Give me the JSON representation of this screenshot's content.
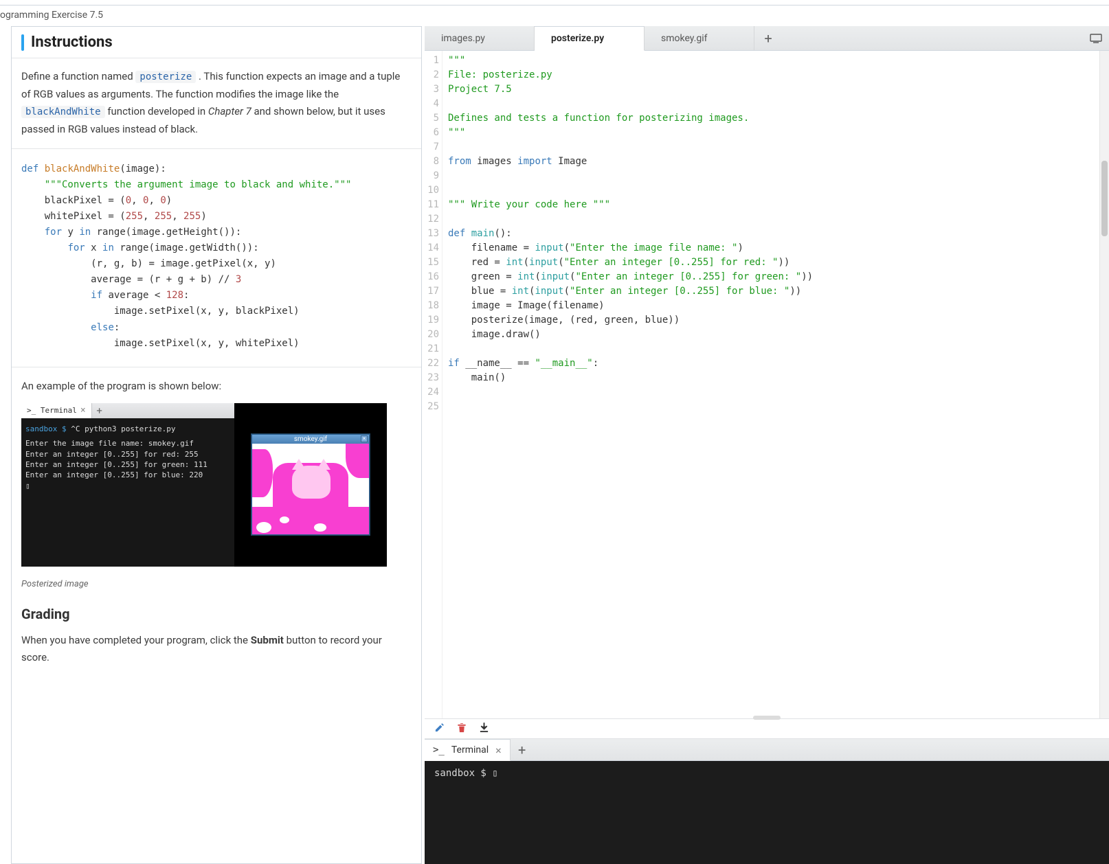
{
  "breadcrumb": "ogramming Exercise 7.5",
  "instructions": {
    "title": "Instructions",
    "p1a": "Define a function named ",
    "code1": "posterize",
    "p1b": ". This function expects an image and a tuple of RGB values as arguments. The function modifies the image like the ",
    "code2": "blackAndWhite",
    "p1c": " function developed in ",
    "chapter": "Chapter 7",
    "p1d": " and shown below, but it uses passed in RGB values instead of black.",
    "codeblock": {
      "l1a": "def",
      "l1b": "blackAndWhite",
      "l1c": "(image):",
      "l2": "\"\"\"Converts the argument image to black and white.\"\"\"",
      "l3a": "blackPixel = (",
      "l3b": "0",
      "l3c": "0",
      "l3d": "0",
      "l3e": ")",
      "l4a": "whitePixel = (",
      "l4b": "255",
      "l4c": "255",
      "l4d": "255",
      "l4e": ")",
      "l5a": "for",
      "l5b": "y",
      "l5c": "in",
      "l5d": "range(image.getHeight()):",
      "l6a": "for",
      "l6b": "x",
      "l6c": "in",
      "l6d": "range(image.getWidth()):",
      "l7": "(r, g, b) = image.getPixel(x, y)",
      "l8a": "average = (r + g + b) //",
      "l8b": "3",
      "l9a": "if",
      "l9b": "average <",
      "l9c": "128",
      "l9d": ":",
      "l10": "image.setPixel(x, y, blackPixel)",
      "l11a": "else",
      "l11b": ":",
      "l12": "image.setPixel(x, y, whitePixel)"
    },
    "example_head": "An example of the program is shown below:",
    "example_terminal_tab": ">_  Terminal",
    "example_terminal_prompt": "sandbox $",
    "example_terminal_cmd": " ^C python3 posterize.py",
    "example_lines": [
      "Enter the image file name: smokey.gif",
      "Enter an integer [0..255] for red: 255",
      "Enter an integer [0..255] for green: 111",
      "Enter an integer [0..255] for blue: 220"
    ],
    "mini_window_title": "smokey.gif",
    "caption": "Posterized image",
    "grading_h": "Grading",
    "grading_p1a": "When you have completed your program, click the ",
    "grading_bold": "Submit",
    "grading_p1b": " button to record your score."
  },
  "tabs": {
    "t1": "images.py",
    "t2": "posterize.py",
    "t3": "smokey.gif"
  },
  "editor": {
    "lines": [
      {
        "n": 1,
        "html": "<span class='py-str'>\"\"\"</span>"
      },
      {
        "n": 2,
        "html": "<span class='py-str'>File: posterize.py</span>"
      },
      {
        "n": 3,
        "html": "<span class='py-str'>Project 7.5</span>"
      },
      {
        "n": 4,
        "html": ""
      },
      {
        "n": 5,
        "html": "<span class='py-str'>Defines and tests a function for posterizing images.</span>"
      },
      {
        "n": 6,
        "html": "<span class='py-str'>\"\"\"</span>"
      },
      {
        "n": 7,
        "html": ""
      },
      {
        "n": 8,
        "html": "<span class='py-kw'>from</span> images <span class='py-kw'>import</span> Image"
      },
      {
        "n": 9,
        "html": ""
      },
      {
        "n": 10,
        "html": ""
      },
      {
        "n": 11,
        "html": "<span class='py-str'>\"\"\" Write your code here \"\"\"</span>"
      },
      {
        "n": 12,
        "html": ""
      },
      {
        "n": 13,
        "html": "<span class='py-kw'>def</span> <span class='py-fn'>main</span>():"
      },
      {
        "n": 14,
        "html": "    filename = <span class='py-fn'>input</span>(<span class='py-str'>\"Enter the image file name: \"</span>)"
      },
      {
        "n": 15,
        "html": "    red = <span class='py-fn'>int</span>(<span class='py-fn'>input</span>(<span class='py-str'>\"Enter an integer [0..255] for red: \"</span>))"
      },
      {
        "n": 16,
        "html": "    green = <span class='py-fn'>int</span>(<span class='py-fn'>input</span>(<span class='py-str'>\"Enter an integer [0..255] for green: \"</span>))"
      },
      {
        "n": 17,
        "html": "    blue = <span class='py-fn'>int</span>(<span class='py-fn'>input</span>(<span class='py-str'>\"Enter an integer [0..255] for blue: \"</span>))"
      },
      {
        "n": 18,
        "html": "    image = Image(filename)"
      },
      {
        "n": 19,
        "html": "    posterize(image, (red, green, blue))"
      },
      {
        "n": 20,
        "html": "    image.draw()"
      },
      {
        "n": 21,
        "html": ""
      },
      {
        "n": 22,
        "html": "<span class='py-kw'>if</span> __name__ == <span class='py-str'>\"__main__\"</span>:"
      },
      {
        "n": 23,
        "html": "    main()"
      },
      {
        "n": 24,
        "html": ""
      },
      {
        "n": 25,
        "html": ""
      }
    ]
  },
  "terminal": {
    "tab_label": "Terminal",
    "prompt": "sandbox $",
    "cursor": "▯"
  }
}
